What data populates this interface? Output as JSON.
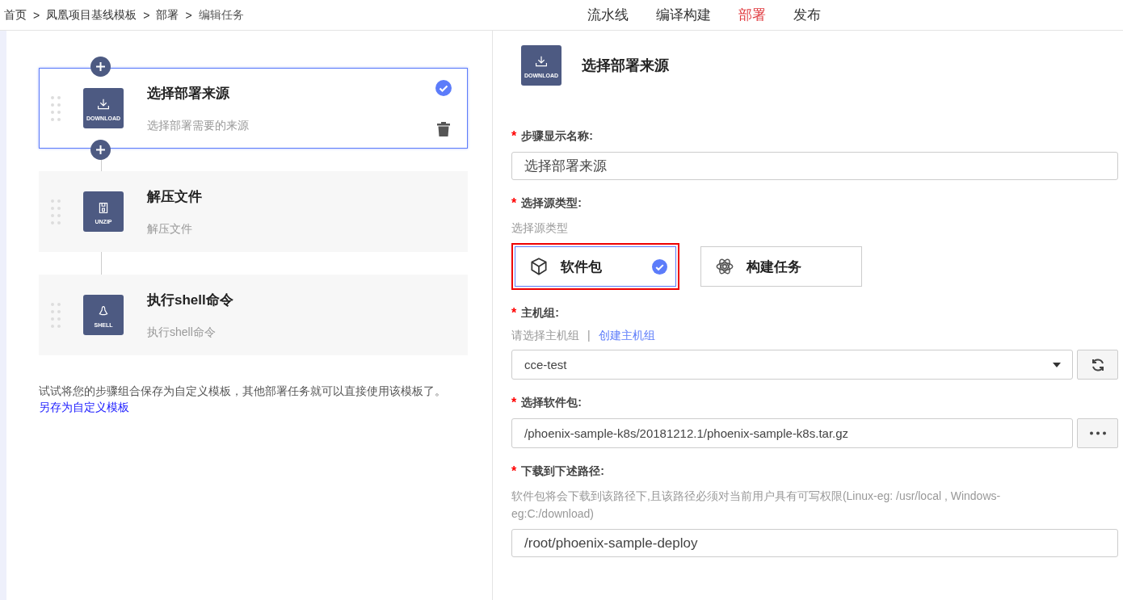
{
  "breadcrumb": [
    "首页",
    "凤凰项目基线模板",
    "部署",
    "编辑任务"
  ],
  "breadcrumb_separator": ">",
  "nav_tabs": [
    {
      "label": "流水线",
      "selected": false
    },
    {
      "label": "编译构建",
      "selected": false
    },
    {
      "label": "部署",
      "selected": true
    },
    {
      "label": "发布",
      "selected": false
    }
  ],
  "steps": [
    {
      "kind": "download",
      "icon_label": "DOWNLOAD",
      "title": "选择部署来源",
      "description": "选择部署需要的来源",
      "selected": true
    },
    {
      "kind": "unzip",
      "icon_label": "UNZIP",
      "title": "解压文件",
      "description": "解压文件",
      "selected": false
    },
    {
      "kind": "shell",
      "icon_label": "SHELL",
      "title": "执行shell命令",
      "description": "执行shell命令",
      "selected": false
    }
  ],
  "template_hint": "试试将您的步骤组合保存为自定义模板，其他部署任务就可以直接使用该模板了。",
  "template_link": "另存为自定义模板",
  "detail": {
    "kind": "download",
    "icon_label": "DOWNLOAD",
    "title": "选择部署来源"
  },
  "form": [
    {
      "kind": "text",
      "label": "步骤显示名称:",
      "required_mark": "*",
      "value": "选择部署来源"
    },
    {
      "kind": "source",
      "label": "选择源类型:",
      "required_mark": "*",
      "hint": "选择源类型",
      "options": [
        {
          "kind": "package",
          "label": "软件包",
          "selected": true,
          "highlighted": true
        },
        {
          "kind": "build",
          "label": "构建任务",
          "selected": false,
          "highlighted": false
        }
      ]
    },
    {
      "kind": "select",
      "label": "主机组:",
      "required_mark": "*",
      "hint": "请选择主机组",
      "separator": "|",
      "link": "创建主机组",
      "value": "cce-test"
    },
    {
      "kind": "browse",
      "label": "选择软件包:",
      "required_mark": "*",
      "value": "/phoenix-sample-k8s/20181212.1/phoenix-sample-k8s.tar.gz"
    },
    {
      "kind": "text",
      "label": "下载到下述路径:",
      "required_mark": "*",
      "hint": "软件包将会下载到该路径下,且该路径必须对当前用户具有可写权限(Linux-eg: /usr/local , Windows-eg:C:/download)",
      "value": "/root/phoenix-sample-deploy"
    }
  ]
}
